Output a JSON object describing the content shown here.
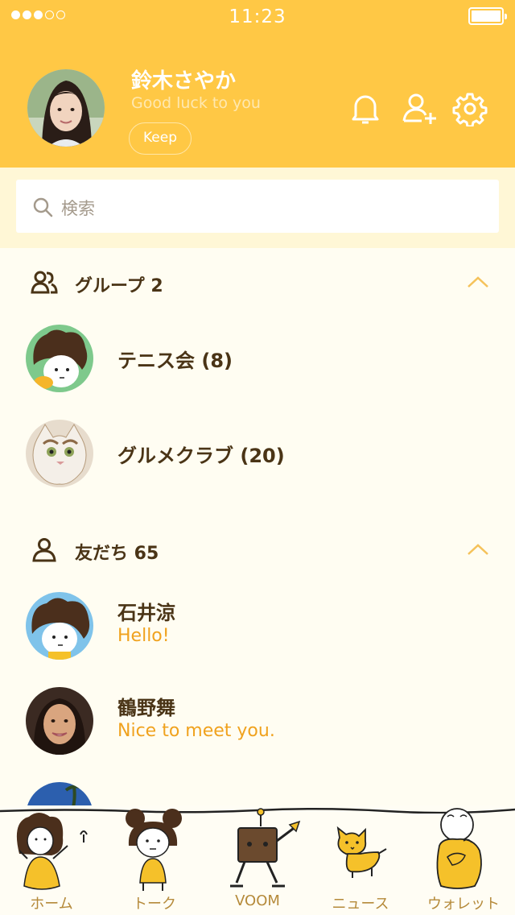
{
  "status_bar": {
    "time": "11:23"
  },
  "profile": {
    "name": "鈴木さやか",
    "status_message": "Good luck to you",
    "keep_label": "Keep"
  },
  "search": {
    "placeholder": "検索"
  },
  "groups": {
    "title": "グループ 2",
    "items": [
      {
        "name": "テニス会 (8)"
      },
      {
        "name": "グルメクラブ (20)"
      }
    ]
  },
  "friends": {
    "title": "友だち 65",
    "items": [
      {
        "name": "石井涼",
        "message": "Hello!"
      },
      {
        "name": "鶴野舞",
        "message": "Nice to meet you."
      }
    ]
  },
  "bottom_nav": {
    "items": [
      {
        "label": "ホーム",
        "icon": "home-icon"
      },
      {
        "label": "トーク",
        "icon": "talk-icon"
      },
      {
        "label": "VOOM",
        "icon": "voom-icon"
      },
      {
        "label": "ニュース",
        "icon": "news-icon"
      },
      {
        "label": "ウォレット",
        "icon": "wallet-icon"
      }
    ]
  },
  "colors": {
    "header": "#ffc845",
    "accent_text": "#f0a21e",
    "dark_text": "#4a3416",
    "background": "#fffdf2"
  }
}
